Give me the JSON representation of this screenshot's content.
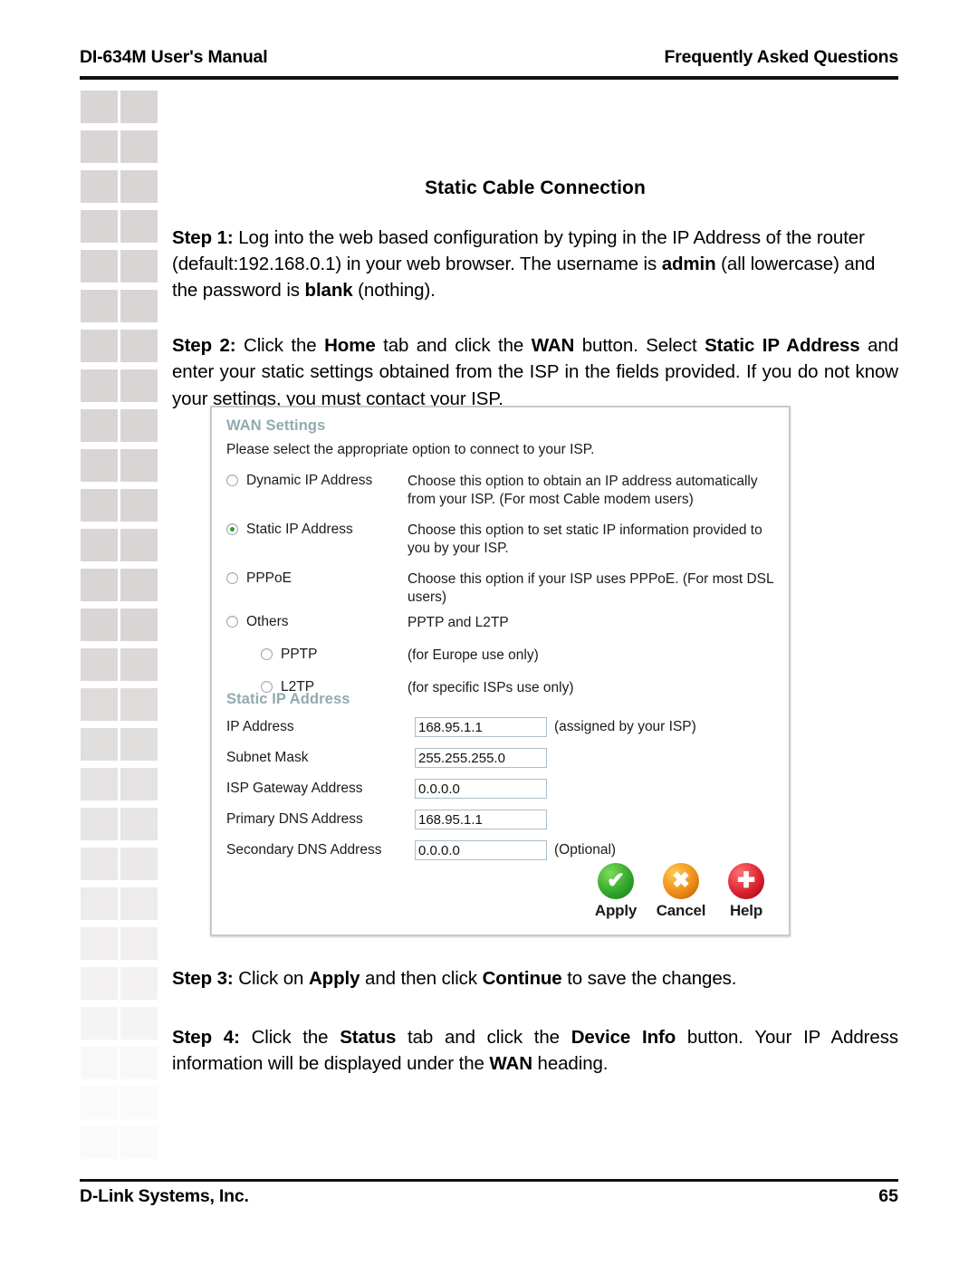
{
  "header": {
    "left": "DI-634M User's Manual",
    "right": "Frequently Asked Questions"
  },
  "footer": {
    "left": "D-Link Systems, Inc.",
    "page_number": "65"
  },
  "content": {
    "section_title": "Static Cable Connection",
    "step1": {
      "label": "Step 1:",
      "text_a": " Log into the web based configuration by typing in the IP Address of the router (default:192.168.0.1) in your web browser. The username is ",
      "bold_a": "admin",
      "text_b": " (all lowercase) and the password is ",
      "bold_b": "blank",
      "text_c": " (nothing)."
    },
    "step2": {
      "label": "Step 2:",
      "text_a": " Click the ",
      "bold_a": "Home",
      "text_b": " tab and click the ",
      "bold_b": "WAN",
      "text_c": " button. Select ",
      "bold_c": "Static IP Address",
      "text_d": " and enter your static settings obtained from the ISP in the fields provided. If you do not know your settings, you must contact your ISP."
    },
    "step3": {
      "label": "Step 3:",
      "text_a": " Click on ",
      "bold_a": "Apply",
      "text_b": " and then click ",
      "bold_b": "Continue",
      "text_c": " to save the changes."
    },
    "step4": {
      "label": "Step 4:",
      "text_a": " Click the ",
      "bold_a": "Status",
      "text_b": " tab and click the ",
      "bold_b": "Device Info",
      "text_c": " button. Your IP Address information will be displayed under the ",
      "bold_c": "WAN",
      "text_d": " heading."
    }
  },
  "wan_panel": {
    "heading": "WAN Settings",
    "intro": "Please select the appropriate option to connect to your ISP.",
    "connection_options": [
      {
        "label": "Dynamic IP Address",
        "selected": false,
        "indented": false,
        "description": "Choose this option to obtain an IP address automatically from your ISP. (For most Cable modem users)"
      },
      {
        "label": "Static IP Address",
        "selected": true,
        "indented": false,
        "description": "Choose this option to set static IP information provided to you by your ISP."
      },
      {
        "label": "PPPoE",
        "selected": false,
        "indented": false,
        "description": "Choose this option if your ISP uses PPPoE. (For most DSL users)"
      },
      {
        "label": "Others",
        "selected": false,
        "indented": false,
        "description": "PPTP and L2TP"
      },
      {
        "label": "PPTP",
        "selected": false,
        "indented": true,
        "description": "(for Europe use only)"
      },
      {
        "label": "L2TP",
        "selected": false,
        "indented": true,
        "description": "(for specific ISPs use only)"
      }
    ],
    "static_section": {
      "heading": "Static IP Address",
      "fields": [
        {
          "label": "IP Address",
          "value": "168.95.1.1",
          "hint": "(assigned by your ISP)"
        },
        {
          "label": "Subnet Mask",
          "value": "255.255.255.0",
          "hint": ""
        },
        {
          "label": "ISP Gateway Address",
          "value": "0.0.0.0",
          "hint": ""
        },
        {
          "label": "Primary DNS Address",
          "value": "168.95.1.1",
          "hint": ""
        },
        {
          "label": "Secondary DNS Address",
          "value": "0.0.0.0",
          "hint": "(Optional)"
        }
      ]
    },
    "actions": [
      {
        "label": "Apply",
        "icon": "green-check-icon",
        "glyph": "✔",
        "color": "#2f9e29"
      },
      {
        "label": "Cancel",
        "icon": "orange-cross-icon",
        "glyph": "✖",
        "color": "#ec8a15"
      },
      {
        "label": "Help",
        "icon": "red-plus-icon",
        "glyph": "✚",
        "color": "#d8202e"
      }
    ]
  },
  "decoration": {
    "square_color": "#d9d5d5",
    "columns": 2,
    "rows": 27
  }
}
